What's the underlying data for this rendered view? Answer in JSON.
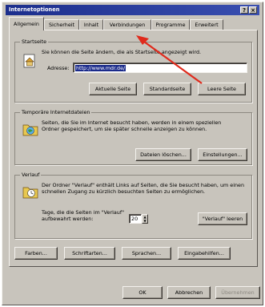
{
  "window": {
    "title": "Internetoptionen",
    "title_buttons": [
      "?",
      "×"
    ]
  },
  "tabs": [
    "Allgemein",
    "Sicherheit",
    "Inhalt",
    "Verbindungen",
    "Programme",
    "Erweitert"
  ],
  "startseite": {
    "legend": "Startseite",
    "description": "Sie können die Seite ändern, die als Startseite angezeigt wird.",
    "address_label": "Adresse:",
    "address_value": "http://www.mdr.de/",
    "buttons": [
      "Aktuelle Seite",
      "Standardseite",
      "Leere Seite"
    ]
  },
  "temp_files": {
    "legend": "Temporäre Internetdateien",
    "description": "Seiten, die Sie im Internet besucht haben, werden in einem speziellen Ordner gespeichert, um sie später schnelle anzeigen zu können.",
    "buttons": [
      "Dateien löschen...",
      "Einstellungen..."
    ]
  },
  "history": {
    "legend": "Verlauf",
    "description": "Der Ordner \"Verlauf\" enthält Links auf Seiten, die Sie besucht haben, um einen schnellen Zugang zu kürzlich besuchten Seiten zu ermöglichen.",
    "days_label": "Tage, die die Seiten im \"Verlauf\" aufbewahrt werden:",
    "days_value": "20",
    "clear_button": "\"Verlauf\" leeren"
  },
  "bottom_buttons": [
    "Farben...",
    "Schriftarten...",
    "Sprachen...",
    "Eingabehilfen..."
  ],
  "dialog_buttons": [
    "OK",
    "Abbrechen",
    "Übernehmen"
  ],
  "colors": {
    "title_bar": "#1c2e8c",
    "face": "#c8c4bc",
    "annotation_arrow": "#e02a1c"
  }
}
